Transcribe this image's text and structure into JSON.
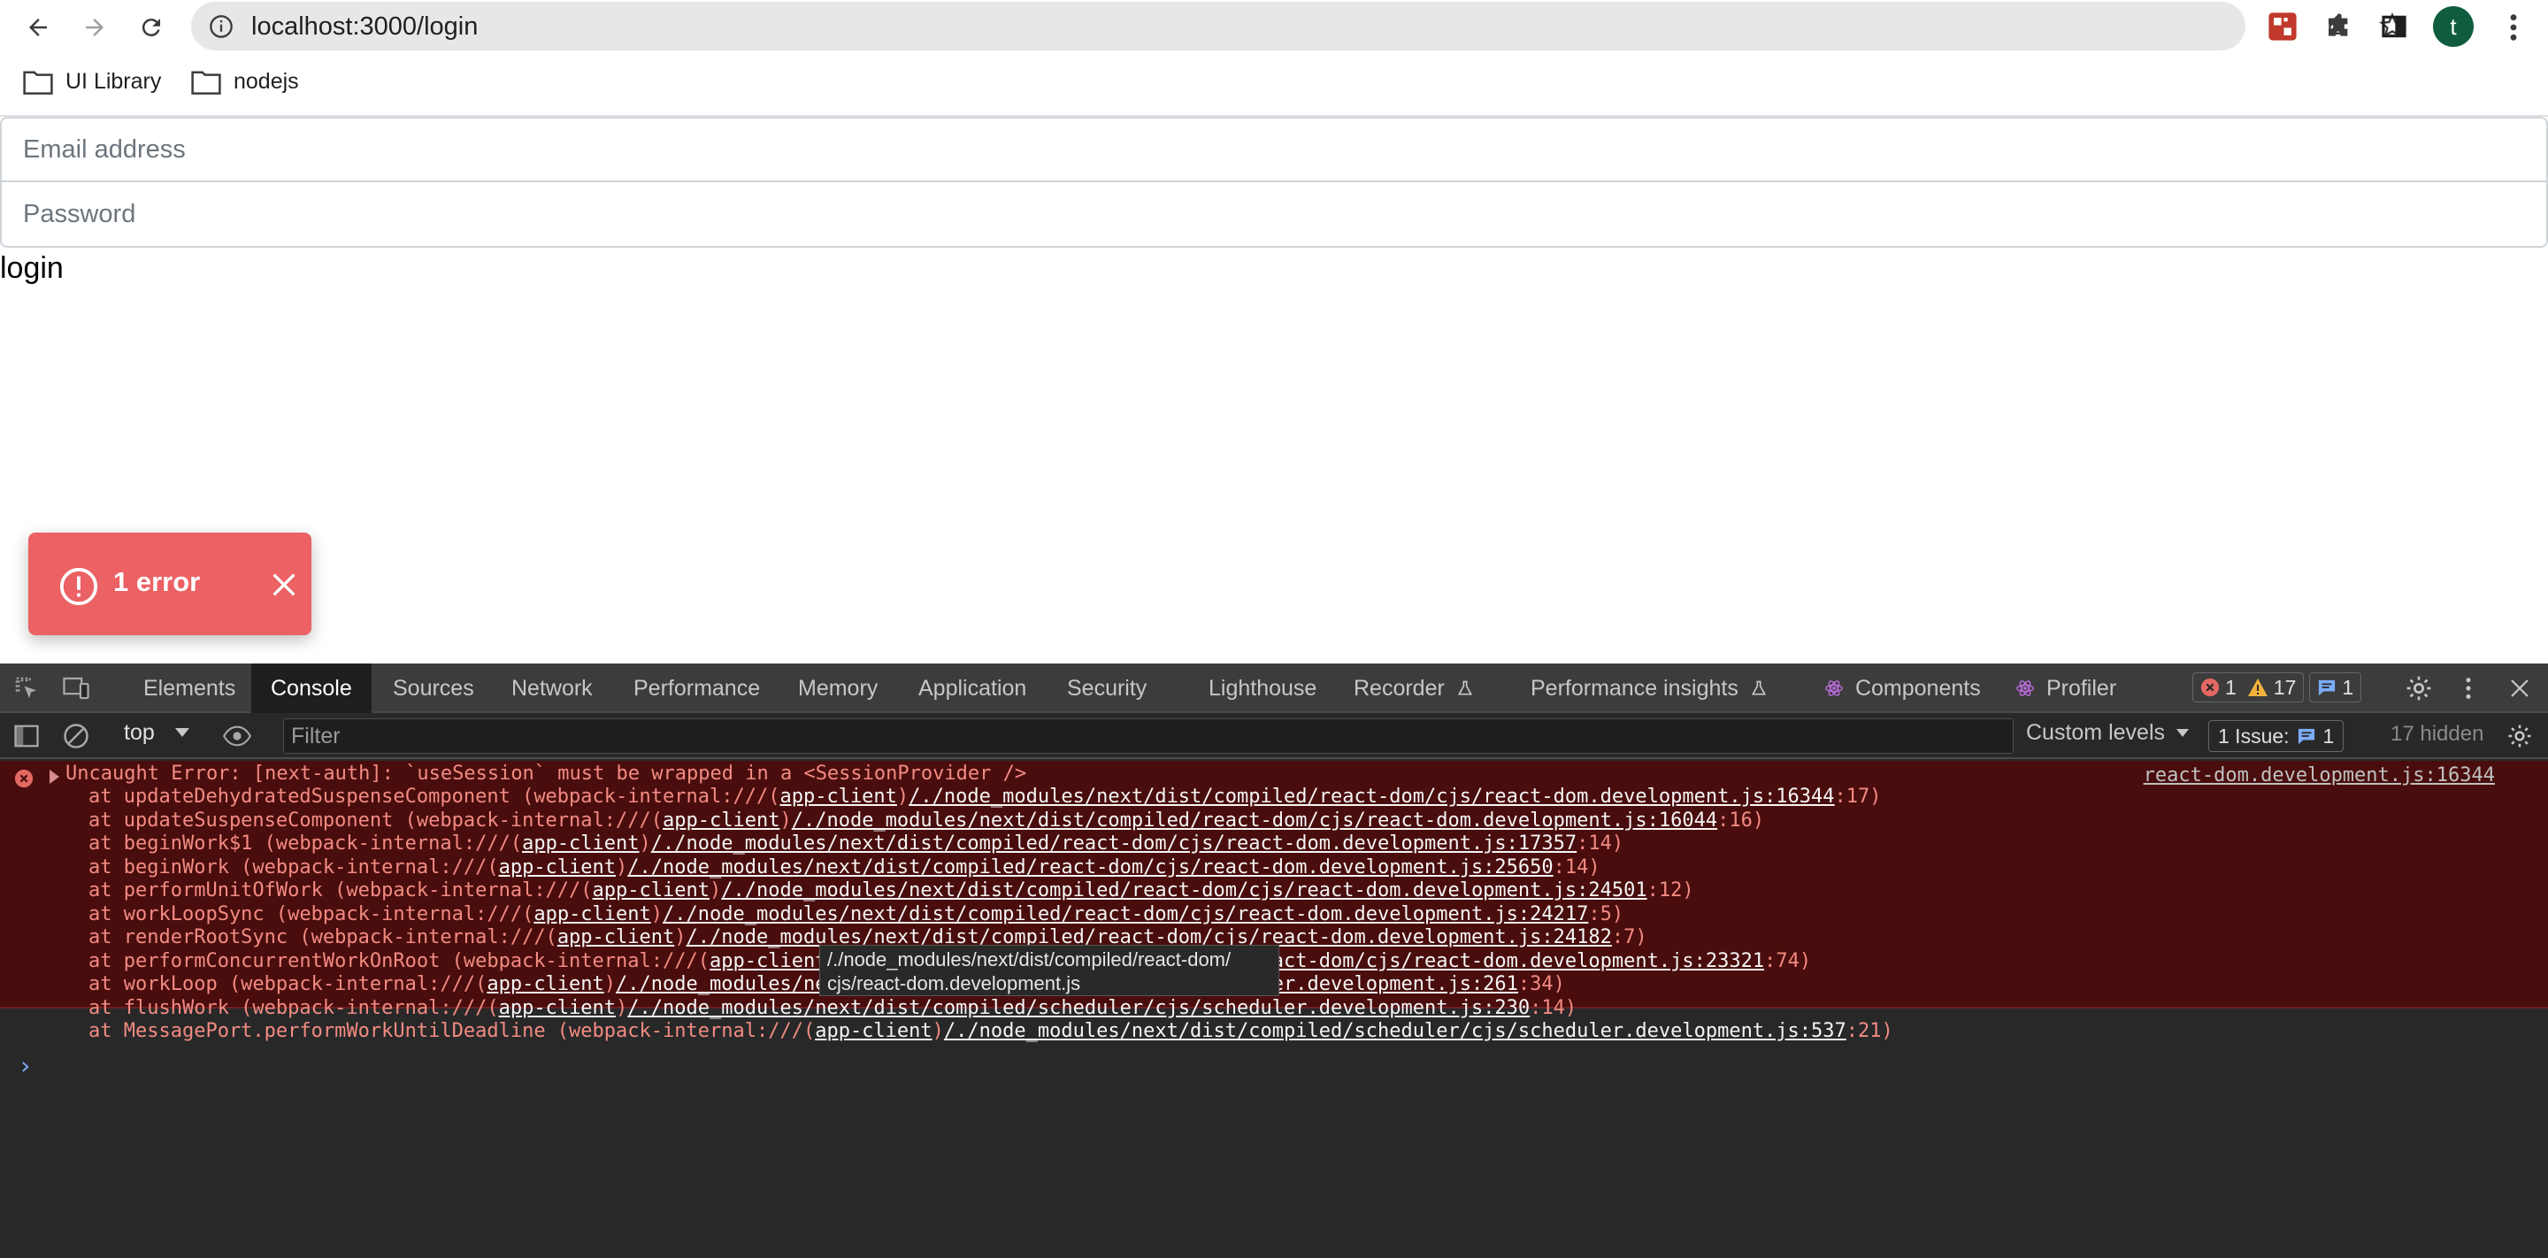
{
  "browser": {
    "url": "localhost:3000/login",
    "avatar_letter": "t",
    "bookmarks": [
      {
        "label": "UI Library",
        "icon": "folder-icon"
      },
      {
        "label": "nodejs",
        "icon": "folder-icon"
      }
    ]
  },
  "page": {
    "email_placeholder": "Email address",
    "password_placeholder": "Password",
    "login_text": "login",
    "error_toast": "1 error"
  },
  "devtools": {
    "tabs": [
      "Elements",
      "Console",
      "Sources",
      "Network",
      "Performance",
      "Memory",
      "Application",
      "Security",
      "Lighthouse",
      "Recorder",
      "Performance insights",
      "Components",
      "Profiler"
    ],
    "active_tab": "Console",
    "error_count": "1",
    "warning_count": "17",
    "info_count": "1",
    "context": "top",
    "filter_placeholder": "Filter",
    "levels": "Custom levels",
    "issues_label": "1 Issue:",
    "issues_count": "1",
    "hidden_count": "17 hidden",
    "error_message": "Uncaught Error: [next-auth]: `useSession` must be wrapped in a <SessionProvider />",
    "error_source": "react-dom.development.js:16344",
    "stack": [
      {
        "fn": "at updateDehydratedSuspenseComponent (webpack-internal:///(",
        "app": "app-client",
        "sep": ")",
        "path": "/./node_modules/next/dist/compiled/react-dom/cjs/react-dom.development.js:16344",
        "pos": ":17)"
      },
      {
        "fn": "at updateSuspenseComponent (webpack-internal:///(",
        "app": "app-client",
        "sep": ")",
        "path": "/./node_modules/next/dist/compiled/react-dom/cjs/react-dom.development.js:16044",
        "pos": ":16)"
      },
      {
        "fn": "at beginWork$1 (webpack-internal:///(",
        "app": "app-client",
        "sep": ")",
        "path": "/./node_modules/next/dist/compiled/react-dom/cjs/react-dom.development.js:17357",
        "pos": ":14)"
      },
      {
        "fn": "at beginWork (webpack-internal:///(",
        "app": "app-client",
        "sep": ")",
        "path": "/./node_modules/next/dist/compiled/react-dom/cjs/react-dom.development.js:25650",
        "pos": ":14)"
      },
      {
        "fn": "at performUnitOfWork (webpack-internal:///(",
        "app": "app-client",
        "sep": ")",
        "path": "/./node_modules/next/dist/compiled/react-dom/cjs/react-dom.development.js:24501",
        "pos": ":12)"
      },
      {
        "fn": "at workLoopSync (webpack-internal:///(",
        "app": "app-client",
        "sep": ")",
        "path": "/./node_modules/next/dist/compiled/react-dom/cjs/react-dom.development.js:24217",
        "pos": ":5)"
      },
      {
        "fn": "at renderRootSync (webpack-internal:///(",
        "app": "app-client",
        "sep": ")",
        "path": "/./node_modules/next/dist/compiled/react-dom/cjs/react-dom.development.js:24182",
        "pos": ":7)"
      },
      {
        "fn": "at performConcurrentWorkOnRoot (webpack-internal:///(",
        "app": "app-client",
        "sep": ")",
        "path": "/./node_modules/next/dist/compiled/react-dom/cjs/react-dom.development.js:23321",
        "pos": ":74)"
      },
      {
        "fn": "at workLoop (webpack-internal:///(",
        "app": "app-client",
        "sep": ")",
        "path": "/./node_modules/next/dist/compiled/scheduler/cjs/scheduler.development.js:261",
        "pos": ":34)"
      },
      {
        "fn": "at flushWork (webpack-internal:///(",
        "app": "app-client",
        "sep": ")",
        "path": "/./node_modules/next/dist/compiled/scheduler/cjs/scheduler.development.js:230",
        "pos": ":14)"
      },
      {
        "fn": "at MessagePort.performWorkUntilDeadline (webpack-internal:///(",
        "app": "app-client",
        "sep": ")",
        "path": "/./node_modules/next/dist/compiled/scheduler/cjs/scheduler.development.js:537",
        "pos": ":21)"
      }
    ],
    "tooltip_line1": "/./node_modules/next/dist/compiled/react-dom/",
    "tooltip_line2": "cjs/react-dom.development.js",
    "prompt": "›"
  },
  "colors": {
    "toast_bg": "#eb6164",
    "error_bg": "#4a0d0d",
    "error_text": "#f28b82",
    "devtools_bg": "#282828"
  }
}
